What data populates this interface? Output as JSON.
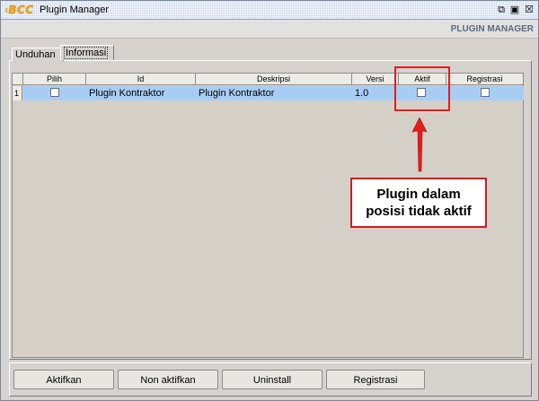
{
  "window": {
    "logo_text": "BCC",
    "title": "Plugin Manager",
    "header_label": "PLUGIN MANAGER"
  },
  "tabs": [
    {
      "label": "Unduhan",
      "active": false
    },
    {
      "label": "Informasi",
      "active": true
    }
  ],
  "table": {
    "columns": [
      "Pilih",
      "Id",
      "Deskripsi",
      "Versi",
      "Aktif",
      "Registrasi"
    ],
    "rows": [
      {
        "num": "1",
        "pilih": false,
        "id": "Plugin Kontraktor",
        "deskripsi": "Plugin Kontraktor",
        "versi": "1.0",
        "aktif": false,
        "registrasi": false
      }
    ]
  },
  "annotation": {
    "line1": "Plugin dalam",
    "line2": "posisi tidak aktif",
    "color": "#e31c1c"
  },
  "buttons": {
    "activate": "Aktifkan",
    "deactivate": "Non aktifkan",
    "uninstall": "Uninstall",
    "register": "Registrasi"
  },
  "icons": {
    "minimize": "restore-icon",
    "maximize": "maximize-icon",
    "close": "close-icon"
  }
}
